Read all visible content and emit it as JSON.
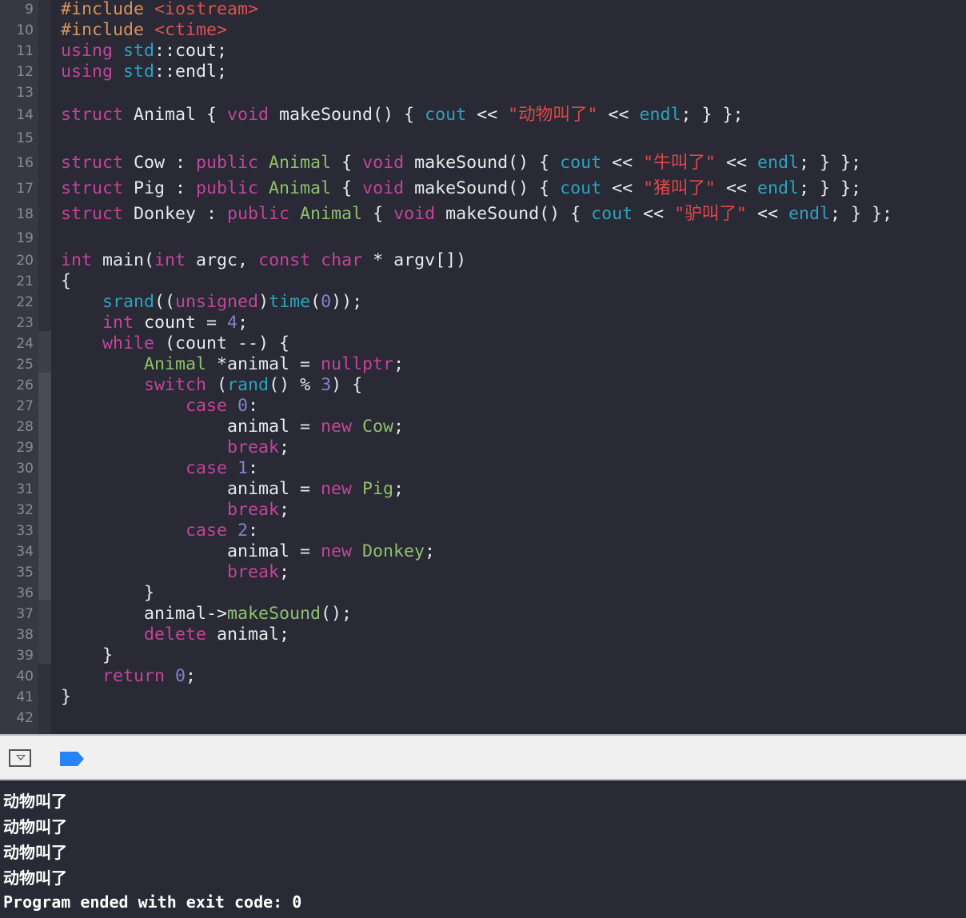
{
  "editor": {
    "lines": [
      {
        "n": "9",
        "t": [
          [
            "pp",
            "#include "
          ],
          [
            "inc",
            "<iostream>"
          ]
        ]
      },
      {
        "n": "10",
        "t": [
          [
            "pp",
            "#include "
          ],
          [
            "inc",
            "<ctime>"
          ]
        ]
      },
      {
        "n": "11",
        "t": [
          [
            "kw",
            "using "
          ],
          [
            "fn",
            "std"
          ],
          [
            "pl",
            "::cout;"
          ]
        ]
      },
      {
        "n": "12",
        "t": [
          [
            "kw",
            "using "
          ],
          [
            "fn",
            "std"
          ],
          [
            "pl",
            "::endl;"
          ]
        ]
      },
      {
        "n": "13",
        "t": []
      },
      {
        "n": "14",
        "t": [
          [
            "kw",
            "struct "
          ],
          [
            "pl",
            "Animal { "
          ],
          [
            "kw",
            "void "
          ],
          [
            "pl",
            "makeSound() { "
          ],
          [
            "fn",
            "cout"
          ],
          [
            "pl",
            " << "
          ],
          [
            "str",
            "\"动物叫了\""
          ],
          [
            "pl",
            " << "
          ],
          [
            "fn",
            "endl"
          ],
          [
            "pl",
            "; } };"
          ]
        ]
      },
      {
        "n": "15",
        "t": []
      },
      {
        "n": "16",
        "t": [
          [
            "kw",
            "struct "
          ],
          [
            "pl",
            "Cow : "
          ],
          [
            "kw",
            "public "
          ],
          [
            "ty",
            "Animal"
          ],
          [
            "pl",
            " { "
          ],
          [
            "kw",
            "void "
          ],
          [
            "pl",
            "makeSound() { "
          ],
          [
            "fn",
            "cout"
          ],
          [
            "pl",
            " << "
          ],
          [
            "str",
            "\"牛叫了\""
          ],
          [
            "pl",
            " << "
          ],
          [
            "fn",
            "endl"
          ],
          [
            "pl",
            "; } };"
          ]
        ]
      },
      {
        "n": "17",
        "t": [
          [
            "kw",
            "struct "
          ],
          [
            "pl",
            "Pig : "
          ],
          [
            "kw",
            "public "
          ],
          [
            "ty",
            "Animal"
          ],
          [
            "pl",
            " { "
          ],
          [
            "kw",
            "void "
          ],
          [
            "pl",
            "makeSound() { "
          ],
          [
            "fn",
            "cout"
          ],
          [
            "pl",
            " << "
          ],
          [
            "str",
            "\"猪叫了\""
          ],
          [
            "pl",
            " << "
          ],
          [
            "fn",
            "endl"
          ],
          [
            "pl",
            "; } };"
          ]
        ]
      },
      {
        "n": "18",
        "t": [
          [
            "kw",
            "struct "
          ],
          [
            "pl",
            "Donkey : "
          ],
          [
            "kw",
            "public "
          ],
          [
            "ty",
            "Animal"
          ],
          [
            "pl",
            " { "
          ],
          [
            "kw",
            "void "
          ],
          [
            "pl",
            "makeSound() { "
          ],
          [
            "fn",
            "cout"
          ],
          [
            "pl",
            " << "
          ],
          [
            "str",
            "\"驴叫了\""
          ],
          [
            "pl",
            " << "
          ],
          [
            "fn",
            "endl"
          ],
          [
            "pl",
            "; } };"
          ]
        ]
      },
      {
        "n": "19",
        "t": []
      },
      {
        "n": "20",
        "t": [
          [
            "kw",
            "int "
          ],
          [
            "pl",
            "main("
          ],
          [
            "kw",
            "int "
          ],
          [
            "pl",
            "argc, "
          ],
          [
            "kw",
            "const char "
          ],
          [
            "pl",
            "* argv[])"
          ]
        ]
      },
      {
        "n": "21",
        "t": [
          [
            "pl",
            "{"
          ]
        ]
      },
      {
        "n": "22",
        "t": [
          [
            "pl",
            "    "
          ],
          [
            "fn",
            "srand"
          ],
          [
            "pl",
            "(("
          ],
          [
            "kw",
            "unsigned"
          ],
          [
            "pl",
            ")"
          ],
          [
            "fn",
            "time"
          ],
          [
            "pl",
            "("
          ],
          [
            "num",
            "0"
          ],
          [
            "pl",
            "));"
          ]
        ]
      },
      {
        "n": "23",
        "t": [
          [
            "pl",
            "    "
          ],
          [
            "kw",
            "int "
          ],
          [
            "pl",
            "count = "
          ],
          [
            "num",
            "4"
          ],
          [
            "pl",
            ";"
          ]
        ]
      },
      {
        "n": "24",
        "t": [
          [
            "pl",
            "    "
          ],
          [
            "kw",
            "while "
          ],
          [
            "pl",
            "(count --) {"
          ]
        ]
      },
      {
        "n": "25",
        "t": [
          [
            "pl",
            "        "
          ],
          [
            "ty",
            "Animal "
          ],
          [
            "pl",
            "*animal = "
          ],
          [
            "kw",
            "nullptr"
          ],
          [
            "pl",
            ";"
          ]
        ]
      },
      {
        "n": "26",
        "t": [
          [
            "pl",
            "        "
          ],
          [
            "kw",
            "switch "
          ],
          [
            "pl",
            "("
          ],
          [
            "fn",
            "rand"
          ],
          [
            "pl",
            "() % "
          ],
          [
            "num",
            "3"
          ],
          [
            "pl",
            ") {"
          ]
        ]
      },
      {
        "n": "27",
        "t": [
          [
            "pl",
            "            "
          ],
          [
            "kw",
            "case "
          ],
          [
            "num",
            "0"
          ],
          [
            "pl",
            ":"
          ]
        ]
      },
      {
        "n": "28",
        "t": [
          [
            "pl",
            "                animal = "
          ],
          [
            "kw",
            "new "
          ],
          [
            "ty",
            "Cow"
          ],
          [
            "pl",
            ";"
          ]
        ]
      },
      {
        "n": "29",
        "t": [
          [
            "pl",
            "                "
          ],
          [
            "kw",
            "break"
          ],
          [
            "pl",
            ";"
          ]
        ]
      },
      {
        "n": "30",
        "t": [
          [
            "pl",
            "            "
          ],
          [
            "kw",
            "case "
          ],
          [
            "num",
            "1"
          ],
          [
            "pl",
            ":"
          ]
        ]
      },
      {
        "n": "31",
        "t": [
          [
            "pl",
            "                animal = "
          ],
          [
            "kw",
            "new "
          ],
          [
            "ty",
            "Pig"
          ],
          [
            "pl",
            ";"
          ]
        ]
      },
      {
        "n": "32",
        "t": [
          [
            "pl",
            "                "
          ],
          [
            "kw",
            "break"
          ],
          [
            "pl",
            ";"
          ]
        ]
      },
      {
        "n": "33",
        "t": [
          [
            "pl",
            "            "
          ],
          [
            "kw",
            "case "
          ],
          [
            "num",
            "2"
          ],
          [
            "pl",
            ":"
          ]
        ]
      },
      {
        "n": "34",
        "t": [
          [
            "pl",
            "                animal = "
          ],
          [
            "kw",
            "new "
          ],
          [
            "ty",
            "Donkey"
          ],
          [
            "pl",
            ";"
          ]
        ]
      },
      {
        "n": "35",
        "t": [
          [
            "pl",
            "                "
          ],
          [
            "kw",
            "break"
          ],
          [
            "pl",
            ";"
          ]
        ]
      },
      {
        "n": "36",
        "t": [
          [
            "pl",
            "        }"
          ]
        ]
      },
      {
        "n": "37",
        "t": [
          [
            "pl",
            "        animal->"
          ],
          [
            "ty",
            "makeSound"
          ],
          [
            "pl",
            "();"
          ]
        ]
      },
      {
        "n": "38",
        "t": [
          [
            "pl",
            "        "
          ],
          [
            "kw",
            "delete "
          ],
          [
            "pl",
            "animal;"
          ]
        ]
      },
      {
        "n": "39",
        "t": [
          [
            "pl",
            "    }"
          ]
        ]
      },
      {
        "n": "40",
        "t": [
          [
            "pl",
            "    "
          ],
          [
            "kw",
            "return "
          ],
          [
            "num",
            "0"
          ],
          [
            "pl",
            ";"
          ]
        ]
      },
      {
        "n": "41",
        "t": [
          [
            "pl",
            "}"
          ]
        ]
      },
      {
        "n": "42",
        "t": []
      }
    ]
  },
  "toolbar": {
    "toggle_icon": "chevron-down-box-icon",
    "run_icon": "breakpoint-tag-icon",
    "run_color": "#2484f5"
  },
  "output": {
    "lines": [
      "动物叫了",
      "动物叫了",
      "动物叫了",
      "动物叫了"
    ],
    "exit_message": "Program ended with exit code: 0"
  }
}
